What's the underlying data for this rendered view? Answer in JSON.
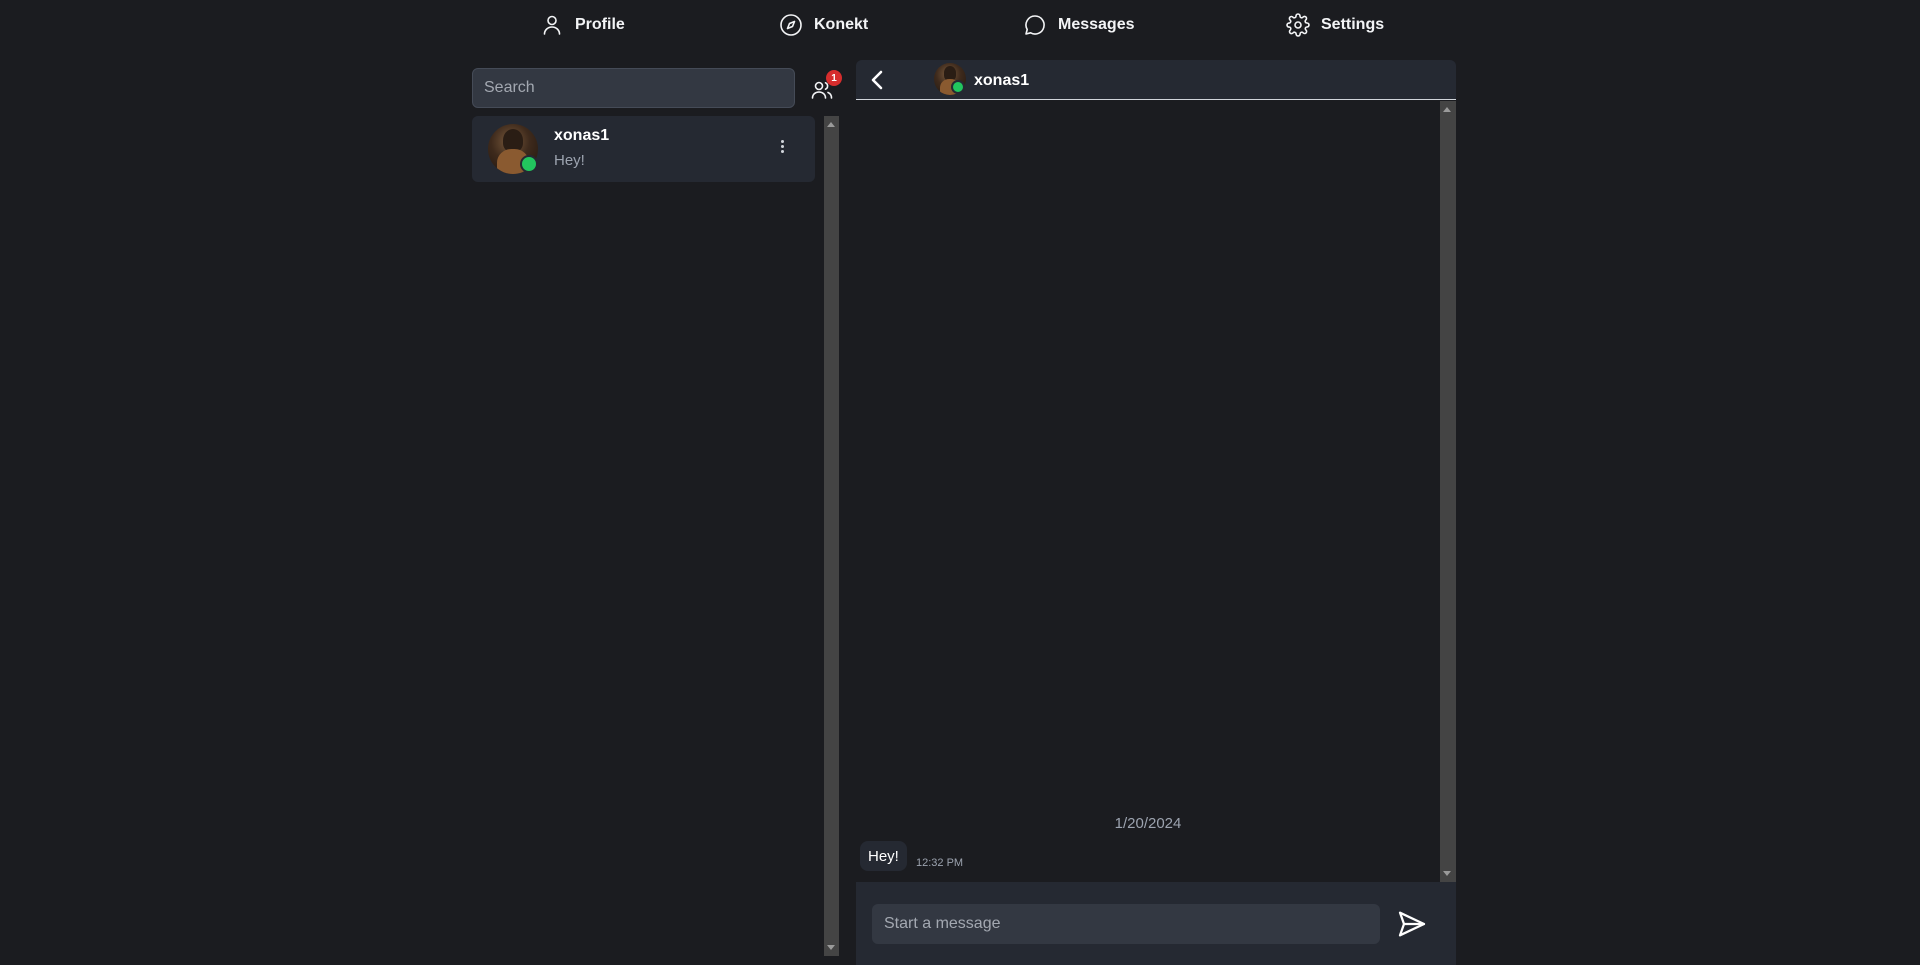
{
  "nav": {
    "profile": {
      "label": "Profile",
      "icon": "user-icon"
    },
    "konekt": {
      "label": "Konekt",
      "icon": "compass-icon"
    },
    "messages": {
      "label": "Messages",
      "icon": "chat-bubble-icon"
    },
    "settings": {
      "label": "Settings",
      "icon": "gear-icon"
    }
  },
  "sidebar": {
    "search_placeholder": "Search",
    "friends_badge": "1",
    "conversations": [
      {
        "name": "xonas1",
        "preview": "Hey!",
        "online": true
      }
    ]
  },
  "chat": {
    "contact_name": "xonas1",
    "date_separator": "1/20/2024",
    "messages": [
      {
        "text": "Hey!",
        "time": "12:32 PM"
      }
    ],
    "input_placeholder": "Start a message"
  },
  "colors": {
    "background": "#1b1c20",
    "panel": "#252932",
    "input": "#333842",
    "online": "#22c55e",
    "badge": "#d62d2d"
  }
}
